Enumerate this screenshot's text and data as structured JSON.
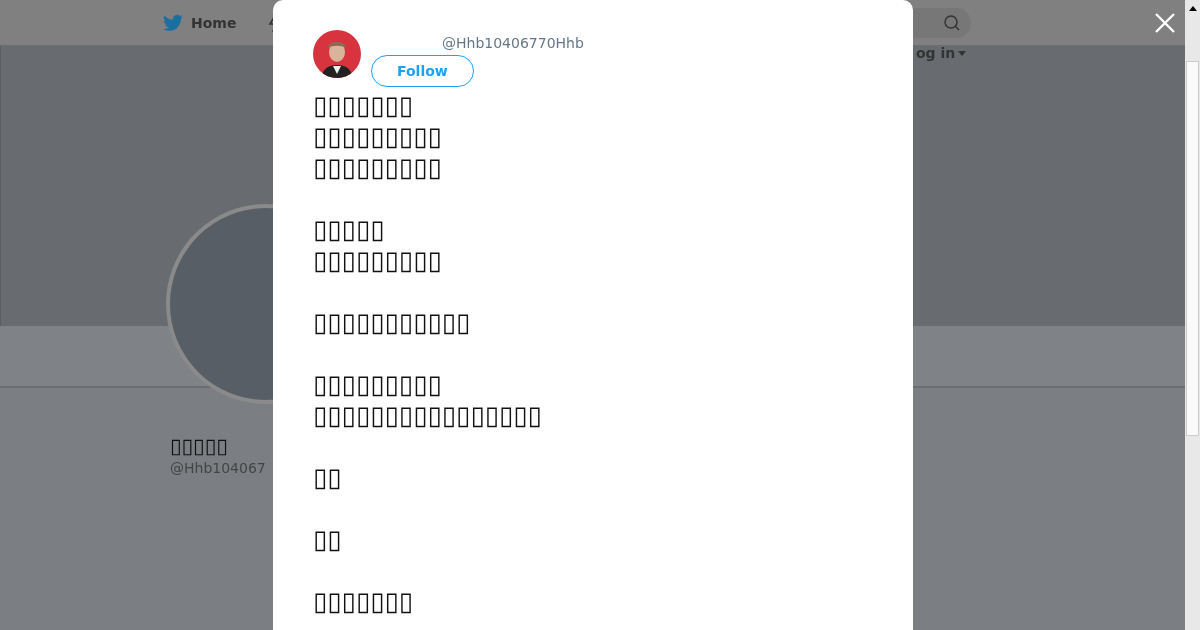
{
  "nav": {
    "home": "Home",
    "login": "og in"
  },
  "profile": {
    "name": "▯▯▯▯▯",
    "handle": "@Hhb104067"
  },
  "tweet": {
    "handle": "@Hhb10406770Hhb",
    "follow": "Follow",
    "text": "▯▯▯▯▯▯▯\n▯▯▯▯▯▯▯▯▯\n▯▯▯▯▯▯▯▯▯\n\n▯▯▯▯▯\n▯▯▯▯▯▯▯▯▯\n\n▯▯▯▯▯▯▯▯▯▯▯\n\n▯▯▯▯▯▯▯▯▯\n▯▯▯▯▯▯▯▯▯▯▯▯▯▯▯▯\n\n▯▯\n\n▯▯\n\n▯▯▯▯▯▯▯"
  }
}
